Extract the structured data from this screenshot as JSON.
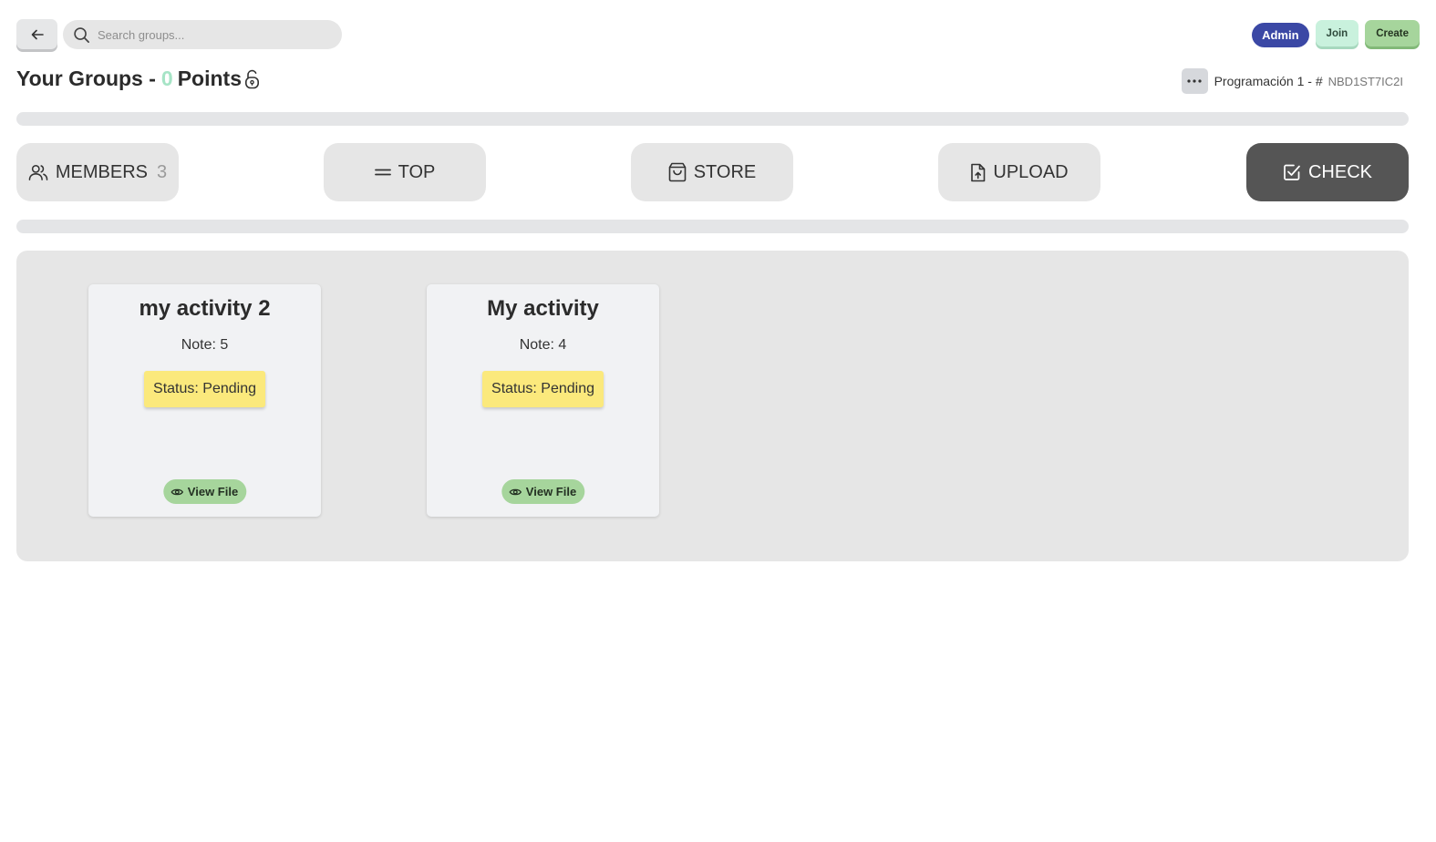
{
  "search": {
    "placeholder": "Search groups..."
  },
  "header_actions": {
    "admin": "Admin",
    "join": "Join",
    "create": "Create"
  },
  "title": {
    "prefix": "Your Groups -",
    "points": "0",
    "suffix": "Points"
  },
  "group": {
    "name": "Programación 1 - #",
    "code": "NBD1ST7IC2I"
  },
  "nav": {
    "members": {
      "label": "MEMBERS",
      "count": "3"
    },
    "top": {
      "label": "TOP"
    },
    "store": {
      "label": "STORE"
    },
    "upload": {
      "label": "UPLOAD"
    },
    "check": {
      "label": "CHECK"
    }
  },
  "activities": [
    {
      "title": "my activity 2",
      "note": "Note: 5",
      "status": "Status: Pending",
      "action": "View File"
    },
    {
      "title": "My activity",
      "note": "Note: 4",
      "status": "Status: Pending",
      "action": "View File"
    }
  ],
  "colors": {
    "accent_points": "#a6e4c6",
    "admin": "#3b48a5",
    "join": "#c9f1dd",
    "create": "#a6d59c",
    "status_pending": "#fbe97c",
    "check_active": "#555555"
  },
  "icons": {
    "back": "arrow-left-icon",
    "search": "search-icon",
    "lock": "lock-open-icon",
    "more": "ellipsis-icon",
    "members": "users-icon",
    "top": "equals-icon",
    "store": "shopping-bag-icon",
    "upload": "file-upload-icon",
    "check": "checkbox-icon",
    "view": "eye-icon"
  }
}
